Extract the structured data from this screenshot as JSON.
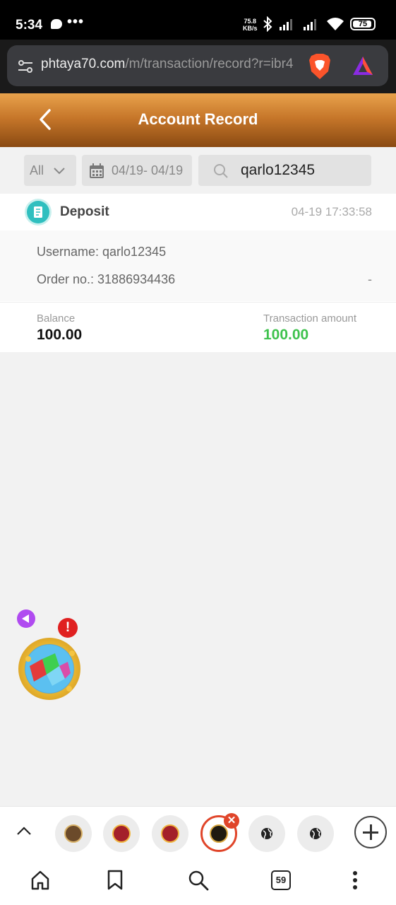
{
  "status_bar": {
    "time": "5:34",
    "dots": "•••",
    "net_speed_value": "75.8",
    "net_speed_unit": "KB/s",
    "battery": "75"
  },
  "browser": {
    "url_domain": "phtaya70.com",
    "url_path": "/m/transaction/record?r=ibr4"
  },
  "header": {
    "title": "Account Record"
  },
  "filters": {
    "type_value": "All",
    "date_range": "04/19- 04/19",
    "search_value": "qarlo12345"
  },
  "record": {
    "type": "Deposit",
    "timestamp": "04-19 17:33:58",
    "username_line": "Username: qarlo12345",
    "order_line": "Order no.: 31886934436",
    "order_extra": "-",
    "balance_label": "Balance",
    "balance_value": "100.00",
    "amount_label": "Transaction amount",
    "amount_value": "100.00"
  },
  "floating": {
    "alert": "!"
  },
  "tabs": {
    "count": "59",
    "close_glyph": "✕"
  },
  "colors": {
    "header_top": "#e8a24c",
    "header_bottom": "#8a4a12",
    "amount_green": "#3ec24d",
    "active_tab_red": "#e0452a"
  }
}
